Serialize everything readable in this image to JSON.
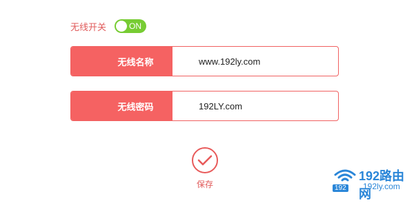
{
  "wireless_switch": {
    "label": "无线开关",
    "state": "ON"
  },
  "fields": {
    "ssid": {
      "label": "无线名称",
      "value": "www.192ly.com"
    },
    "password": {
      "label": "无线密码",
      "value": "192LY.com"
    }
  },
  "save": {
    "label": "保存"
  },
  "watermark": {
    "logo_text": "192路由网",
    "url": "192ly.com",
    "badge": "192"
  },
  "colors": {
    "accent": "#f56262",
    "toggle_on": "#77cc33",
    "watermark": "#2a86d8"
  }
}
